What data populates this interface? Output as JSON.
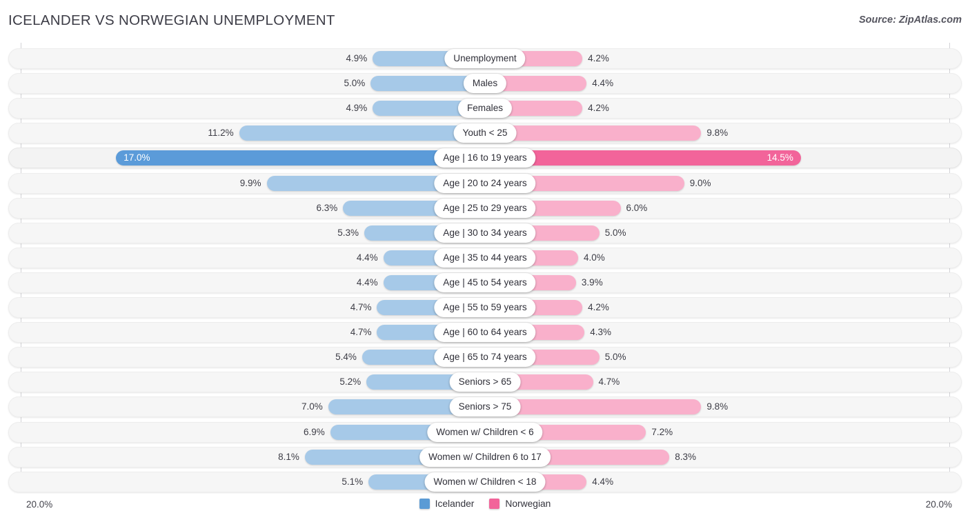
{
  "header": {
    "title": "ICELANDER VS NORWEGIAN UNEMPLOYMENT",
    "source": "Source: ZipAtlas.com"
  },
  "axis": {
    "min_label": "20.0%",
    "max_label": "20.0%",
    "max_value": 20.0
  },
  "legend": {
    "items": [
      {
        "label": "Icelander",
        "color": "#5b9bd5"
      },
      {
        "label": "Norwegian",
        "color": "#f2649a"
      }
    ]
  },
  "colors": {
    "left_normal": "#a6c9e8",
    "right_normal": "#f9b0cb",
    "left_highlight": "#5b9bd9",
    "right_highlight": "#f2649a",
    "track": "#f6f6f6",
    "axis_line": "#d2d2d6",
    "text": "#3d3d46"
  },
  "chart_data": {
    "type": "bar",
    "title": "ICELANDER VS NORWEGIAN UNEMPLOYMENT",
    "subtitle": "",
    "xlabel": "",
    "ylabel": "",
    "orientation": "horizontal-diverging",
    "grid": false,
    "legend_position": "bottom-center",
    "xlim": [
      20.0,
      20.0
    ],
    "axis_unit": "%",
    "categories": [
      "Unemployment",
      "Males",
      "Females",
      "Youth < 25",
      "Age | 16 to 19 years",
      "Age | 20 to 24 years",
      "Age | 25 to 29 years",
      "Age | 30 to 34 years",
      "Age | 35 to 44 years",
      "Age | 45 to 54 years",
      "Age | 55 to 59 years",
      "Age | 60 to 64 years",
      "Age | 65 to 74 years",
      "Seniors > 65",
      "Seniors > 75",
      "Women w/ Children < 6",
      "Women w/ Children 6 to 17",
      "Women w/ Children < 18"
    ],
    "series": [
      {
        "name": "Icelander",
        "side": "left",
        "color": "#a6c9e8",
        "values": [
          4.9,
          5.0,
          4.9,
          11.2,
          17.0,
          9.9,
          6.3,
          5.3,
          4.4,
          4.4,
          4.7,
          4.7,
          5.4,
          5.2,
          7.0,
          6.9,
          8.1,
          5.1
        ]
      },
      {
        "name": "Norwegian",
        "side": "right",
        "color": "#f9b0cb",
        "values": [
          4.2,
          4.4,
          4.2,
          9.8,
          14.5,
          9.0,
          6.0,
          5.0,
          4.0,
          3.9,
          4.2,
          4.3,
          5.0,
          4.7,
          9.8,
          7.2,
          8.3,
          4.4
        ]
      }
    ],
    "highlighted_category": "Age | 16 to 19 years"
  },
  "rows": [
    {
      "label": "Unemployment",
      "left": "4.9%",
      "right": "4.2%",
      "left_value": 4.9,
      "right_value": 4.2,
      "highlight": false
    },
    {
      "label": "Males",
      "left": "5.0%",
      "right": "4.4%",
      "left_value": 5.0,
      "right_value": 4.4,
      "highlight": false
    },
    {
      "label": "Females",
      "left": "4.9%",
      "right": "4.2%",
      "left_value": 4.9,
      "right_value": 4.2,
      "highlight": false
    },
    {
      "label": "Youth < 25",
      "left": "11.2%",
      "right": "9.8%",
      "left_value": 11.2,
      "right_value": 9.8,
      "highlight": false
    },
    {
      "label": "Age | 16 to 19 years",
      "left": "17.0%",
      "right": "14.5%",
      "left_value": 17.0,
      "right_value": 14.5,
      "highlight": true
    },
    {
      "label": "Age | 20 to 24 years",
      "left": "9.9%",
      "right": "9.0%",
      "left_value": 9.9,
      "right_value": 9.0,
      "highlight": false
    },
    {
      "label": "Age | 25 to 29 years",
      "left": "6.3%",
      "right": "6.0%",
      "left_value": 6.3,
      "right_value": 6.0,
      "highlight": false
    },
    {
      "label": "Age | 30 to 34 years",
      "left": "5.3%",
      "right": "5.0%",
      "left_value": 5.3,
      "right_value": 5.0,
      "highlight": false
    },
    {
      "label": "Age | 35 to 44 years",
      "left": "4.4%",
      "right": "4.0%",
      "left_value": 4.4,
      "right_value": 4.0,
      "highlight": false
    },
    {
      "label": "Age | 45 to 54 years",
      "left": "4.4%",
      "right": "3.9%",
      "left_value": 4.4,
      "right_value": 3.9,
      "highlight": false
    },
    {
      "label": "Age | 55 to 59 years",
      "left": "4.7%",
      "right": "4.2%",
      "left_value": 4.7,
      "right_value": 4.2,
      "highlight": false
    },
    {
      "label": "Age | 60 to 64 years",
      "left": "4.7%",
      "right": "4.3%",
      "left_value": 4.7,
      "right_value": 4.3,
      "highlight": false
    },
    {
      "label": "Age | 65 to 74 years",
      "left": "5.4%",
      "right": "5.0%",
      "left_value": 5.4,
      "right_value": 5.0,
      "highlight": false
    },
    {
      "label": "Seniors > 65",
      "left": "5.2%",
      "right": "4.7%",
      "left_value": 5.2,
      "right_value": 4.7,
      "highlight": false
    },
    {
      "label": "Seniors > 75",
      "left": "7.0%",
      "right": "9.8%",
      "left_value": 7.0,
      "right_value": 9.8,
      "highlight": false
    },
    {
      "label": "Women w/ Children < 6",
      "left": "6.9%",
      "right": "7.2%",
      "left_value": 6.9,
      "right_value": 7.2,
      "highlight": false
    },
    {
      "label": "Women w/ Children 6 to 17",
      "left": "8.1%",
      "right": "8.3%",
      "left_value": 8.1,
      "right_value": 8.3,
      "highlight": false
    },
    {
      "label": "Women w/ Children < 18",
      "left": "5.1%",
      "right": "4.4%",
      "left_value": 5.1,
      "right_value": 4.4,
      "highlight": false
    }
  ]
}
